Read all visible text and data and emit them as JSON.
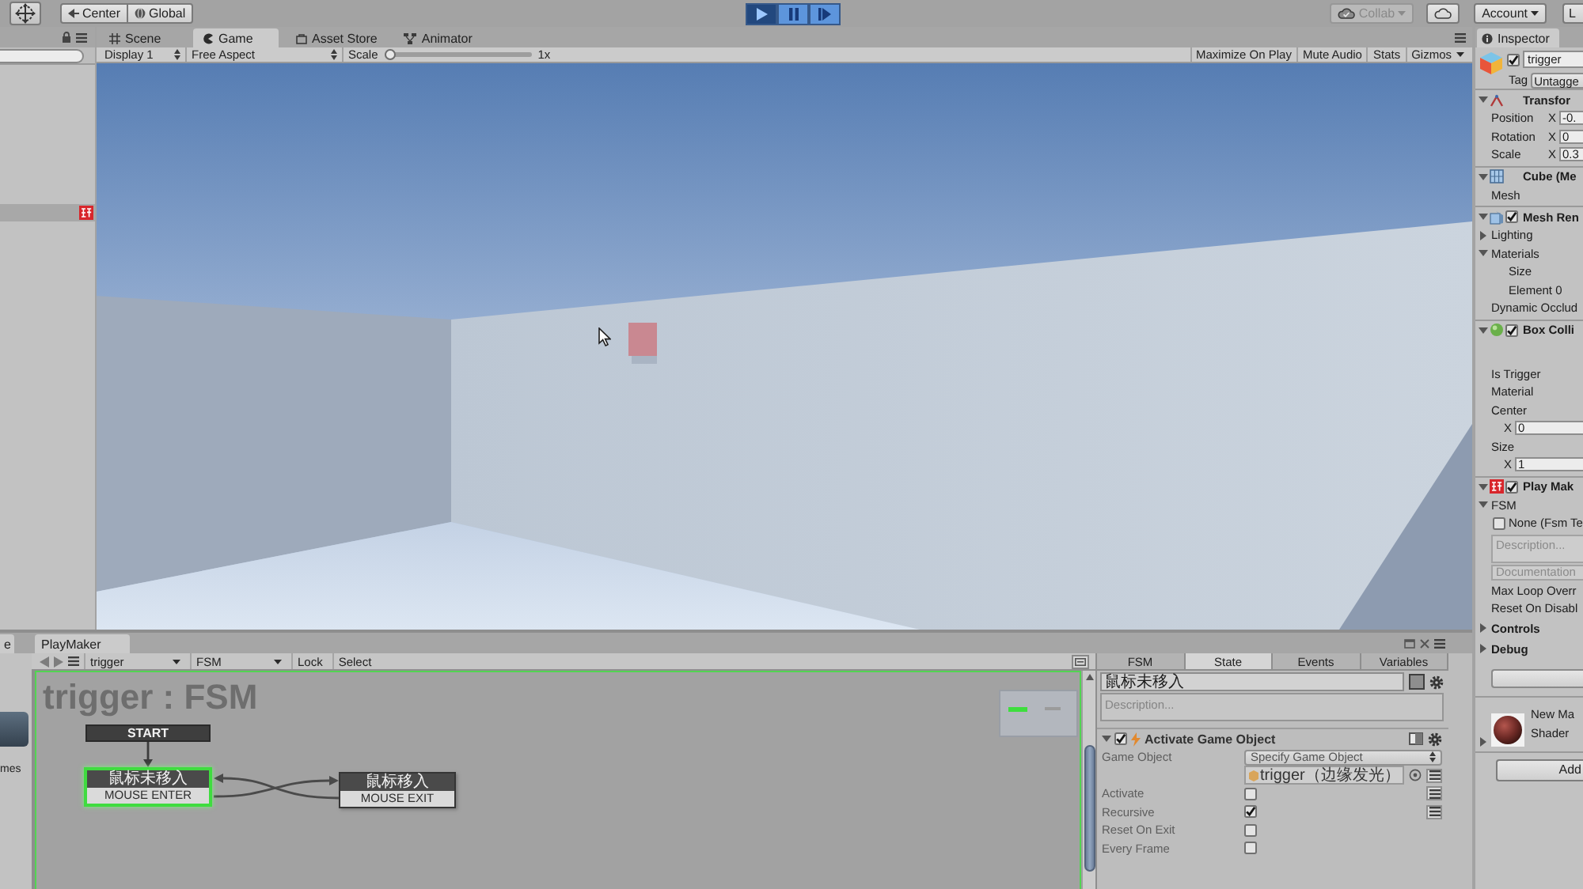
{
  "toolbar": {
    "pivot_buttons": [
      {
        "kind": "pivot",
        "label": "Center"
      },
      {
        "kind": "global",
        "label": "Global"
      }
    ],
    "play_controls": [
      {
        "kind": "play",
        "on": true
      },
      {
        "kind": "pause",
        "on": false
      },
      {
        "kind": "step",
        "on": false
      }
    ],
    "collab": {
      "label": "Collab",
      "disabled": true
    },
    "account": {
      "label": "Account"
    },
    "layers": {
      "label": "L"
    }
  },
  "hierarchy": {
    "rows": [
      {
        "selected": true
      }
    ]
  },
  "scene_tabs": [
    {
      "kind": "scene",
      "label": "Scene",
      "selected": false
    },
    {
      "kind": "game",
      "label": "Game",
      "selected": true
    },
    {
      "kind": "store",
      "label": "Asset Store",
      "selected": false
    },
    {
      "kind": "animator",
      "label": "Animator",
      "selected": false
    }
  ],
  "game_toolbar": {
    "display": "Display 1",
    "aspect": "Free Aspect",
    "scale": {
      "label": "Scale",
      "level": 0,
      "reading": "1x"
    },
    "options": [
      {
        "kind": "toggle",
        "label": "Maximize On Play"
      },
      {
        "kind": "toggle",
        "label": "Mute Audio"
      },
      {
        "kind": "toggle",
        "label": "Stats"
      },
      {
        "kind": "dropdown",
        "label": "Gizmos"
      }
    ]
  },
  "inspector": {
    "tab": "Inspector",
    "object": {
      "active": true,
      "name": "trigger",
      "tag_label": "Tag",
      "tag": "Untagge"
    },
    "components": [
      {
        "kind": "transform",
        "title": "Transfor",
        "expanded": true,
        "rows": [
          {
            "kind": "vector",
            "label": "Position",
            "axis": "X",
            "value": "-0."
          },
          {
            "kind": "vector",
            "label": "Rotation",
            "axis": "X",
            "value": "0"
          },
          {
            "kind": "vector",
            "label": "Scale",
            "axis": "X",
            "value": "0.3"
          }
        ]
      },
      {
        "kind": "mesh_filter",
        "title": "Cube (Me",
        "expanded": true,
        "rows": [
          {
            "kind": "label",
            "label": "Mesh"
          }
        ]
      },
      {
        "kind": "mesh_renderer",
        "title": "Mesh Ren",
        "enabled": true,
        "expanded": true,
        "rows": [
          {
            "kind": "foldout",
            "label": "Lighting",
            "expanded": false
          },
          {
            "kind": "foldout",
            "label": "Materials",
            "expanded": true,
            "children": [
              {
                "kind": "label",
                "label": "Size"
              },
              {
                "kind": "label",
                "label": "Element 0"
              }
            ]
          },
          {
            "kind": "label",
            "label": "Dynamic Occlud"
          }
        ]
      },
      {
        "kind": "box_collider",
        "title": "Box Colli",
        "enabled": true,
        "expanded": true,
        "rows": [
          {
            "kind": "label",
            "label": "Is Trigger"
          },
          {
            "kind": "label",
            "label": "Material"
          },
          {
            "kind": "vector_wide",
            "label": "Center",
            "axis": "X",
            "value": "0"
          },
          {
            "kind": "vector_wide",
            "label": "Size",
            "axis": "X",
            "value": "1"
          }
        ]
      },
      {
        "kind": "playmaker",
        "title": "Play Mak",
        "enabled": true,
        "expanded": true,
        "rows": [
          {
            "kind": "foldout",
            "label": "FSM",
            "expanded": true,
            "children": [
              {
                "kind": "checkbox",
                "label": "None (Fsm Te",
                "checked": false
              },
              {
                "kind": "textarea",
                "placeholder": "Description..."
              },
              {
                "kind": "textfield",
                "placeholder": "Documentation"
              }
            ]
          },
          {
            "kind": "label",
            "label": "Max Loop Overr"
          },
          {
            "kind": "label",
            "label": "Reset On Disabl"
          },
          {
            "kind": "section",
            "label": "Controls",
            "expanded": false
          },
          {
            "kind": "section",
            "label": "Debug",
            "expanded": false
          },
          {
            "kind": "button"
          }
        ]
      },
      {
        "kind": "material",
        "title": "New Ma",
        "subtitle": "Shader",
        "expanded": false
      }
    ],
    "add_button": "Add"
  },
  "project_panel": {
    "tab": "e",
    "item_label": "mes"
  },
  "playmaker": {
    "tab": "PlayMaker",
    "toolbar": {
      "owner": "trigger",
      "fsm": "FSM",
      "lock": "Lock",
      "select": "Select"
    },
    "graph": {
      "title": "trigger : FSM",
      "start": "START",
      "states": [
        {
          "name": "鼠标未移入",
          "event": "MOUSE ENTER",
          "selected": true
        },
        {
          "name": "鼠标移入",
          "event": "MOUSE EXIT",
          "selected": false
        }
      ]
    },
    "panel": {
      "tabs": [
        {
          "label": "FSM",
          "selected": false
        },
        {
          "label": "State",
          "selected": true
        },
        {
          "label": "Events",
          "selected": false
        },
        {
          "label": "Variables",
          "selected": false
        }
      ],
      "state_name": "鼠标未移入",
      "description": {
        "placeholder": "Description..."
      },
      "action": {
        "title": "Activate Game Object",
        "enabled": true,
        "expanded": true,
        "fields": [
          {
            "kind": "dropdown",
            "label": "Game Object",
            "value": "Specify Game Object"
          },
          {
            "kind": "object",
            "value": "trigger（边缘发光）",
            "variable_button": true
          },
          {
            "kind": "checkbox",
            "label": "Activate",
            "checked": false,
            "variable_button": true
          },
          {
            "kind": "checkbox",
            "label": "Recursive",
            "checked": true,
            "variable_button": true
          },
          {
            "kind": "checkbox",
            "label": "Reset On Exit",
            "checked": false
          },
          {
            "kind": "checkbox",
            "label": "Every Frame",
            "checked": false
          }
        ]
      }
    }
  }
}
